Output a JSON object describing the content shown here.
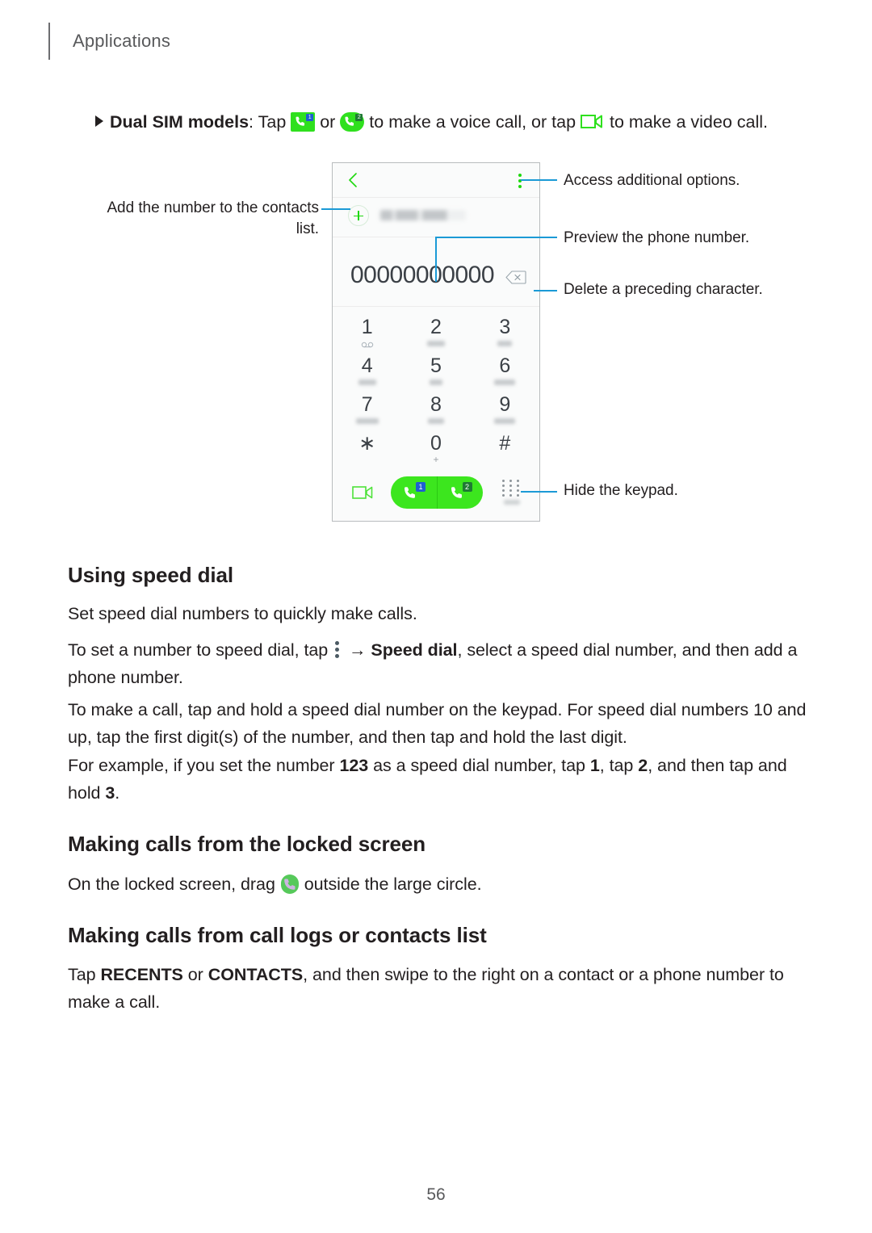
{
  "header": {
    "title": "Applications"
  },
  "intro": {
    "bullet_marker": "triangle-bullet",
    "lead_bold": "Dual SIM models",
    "part1": ": Tap ",
    "icon1": "call-sim1-icon",
    "part2": " or ",
    "icon2": "call-sim2-icon",
    "part3": " to make a voice call, or tap ",
    "icon3": "video-call-icon",
    "part4": " to make a video call."
  },
  "phone": {
    "back_icon": "back-chevron-icon",
    "overflow_icon": "overflow-menu-icon",
    "add_icon": "add-contact-plus-icon",
    "add_label_redacted": "ADD TO CONTACTS",
    "number": "00000000000",
    "backspace_icon": "backspace-icon",
    "keypad": [
      [
        {
          "digit": "1",
          "sub": "voicemail-icon",
          "sub_width": 0
        },
        {
          "digit": "2",
          "sub": "redacted",
          "sub_width": 22
        },
        {
          "digit": "3",
          "sub": "redacted",
          "sub_width": 18
        }
      ],
      [
        {
          "digit": "4",
          "sub": "redacted",
          "sub_width": 22
        },
        {
          "digit": "5",
          "sub": "redacted",
          "sub_width": 16
        },
        {
          "digit": "6",
          "sub": "redacted",
          "sub_width": 26
        }
      ],
      [
        {
          "digit": "7",
          "sub": "redacted",
          "sub_width": 28
        },
        {
          "digit": "8",
          "sub": "redacted",
          "sub_width": 20
        },
        {
          "digit": "9",
          "sub": "redacted",
          "sub_width": 26
        }
      ],
      [
        {
          "digit": "∗",
          "sub": "none",
          "sub_width": 0
        },
        {
          "digit": "0",
          "sub": "plus",
          "sub_width": 0
        },
        {
          "digit": "#",
          "sub": "none",
          "sub_width": 0
        }
      ]
    ],
    "zero_sub_label": "+",
    "actions": {
      "video_icon": "video-call-icon",
      "call_sim1_badge": "1",
      "call_sim2_badge": "2",
      "hide_keypad_icon": "keypad-toggle-icon"
    }
  },
  "callouts": {
    "add_contacts": "Add the number to the contacts list.",
    "additional_options": "Access additional options.",
    "preview_number": "Preview the phone number.",
    "delete_character": "Delete a preceding character.",
    "hide_keypad": "Hide the keypad."
  },
  "sections": [
    {
      "heading": "Using speed dial",
      "paras": [
        "Set speed dial numbers to quickly make calls."
      ]
    },
    {
      "heading": "Making calls from the locked screen",
      "paras": []
    },
    {
      "heading": "Making calls from call logs or contacts list",
      "paras": []
    }
  ],
  "speed_dial": {
    "p1": "Set speed dial numbers to quickly make calls.",
    "p2_a": "To set a number to speed dial, tap ",
    "p2_icon": "overflow-menu-icon",
    "p2_b": " → ",
    "p2_bold": "Speed dial",
    "p2_c": ", select a speed dial number, and then add a phone number.",
    "p3": "To make a call, tap and hold a speed dial number on the keypad. For speed dial numbers 10 and up, tap the first digit(s) of the number, and then tap and hold the last digit.",
    "p4_a": "For example, if you set the number ",
    "p4_b1": "123",
    "p4_b": " as a speed dial number, tap ",
    "p4_b2": "1",
    "p4_c": ", tap ",
    "p4_b3": "2",
    "p4_d": ", and then tap and hold ",
    "p4_b4": "3",
    "p4_e": "."
  },
  "locked_screen": {
    "p_a": "On the locked screen, drag ",
    "p_icon": "lock-screen-call-icon",
    "p_b": " outside the large circle."
  },
  "call_logs": {
    "p_a": "Tap ",
    "p_b1": "RECENTS",
    "p_b": " or ",
    "p_b2": "CONTACTS",
    "p_c": ", and then swipe to the right on a contact or a phone number to make a call."
  },
  "footer": {
    "page_number": "56"
  },
  "colors": {
    "accent_green": "#3ce61e",
    "callout_blue": "#1b9ad6",
    "body_text": "#231f20",
    "muted": "#58595b",
    "sim1_badge": "#1f5fd0",
    "sim2_badge": "#1f7a33"
  }
}
